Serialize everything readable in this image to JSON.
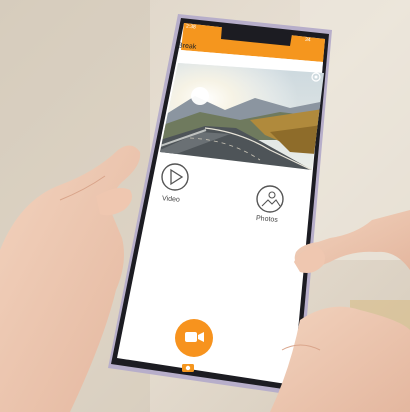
{
  "status_bar": {
    "time": "2:38",
    "battery": "34"
  },
  "app": {
    "back_label": "Break",
    "title": "YI-Q28-WiFi-8e15*",
    "video_label": "Video",
    "photos_label": "Photos",
    "record_icon": "video-camera-icon",
    "settings_icon": "gear-icon",
    "bottom_icon": "camera-icon"
  },
  "colors": {
    "accent": "#f5961e",
    "record_button": "#f7931e",
    "icon_gray": "#555555"
  }
}
